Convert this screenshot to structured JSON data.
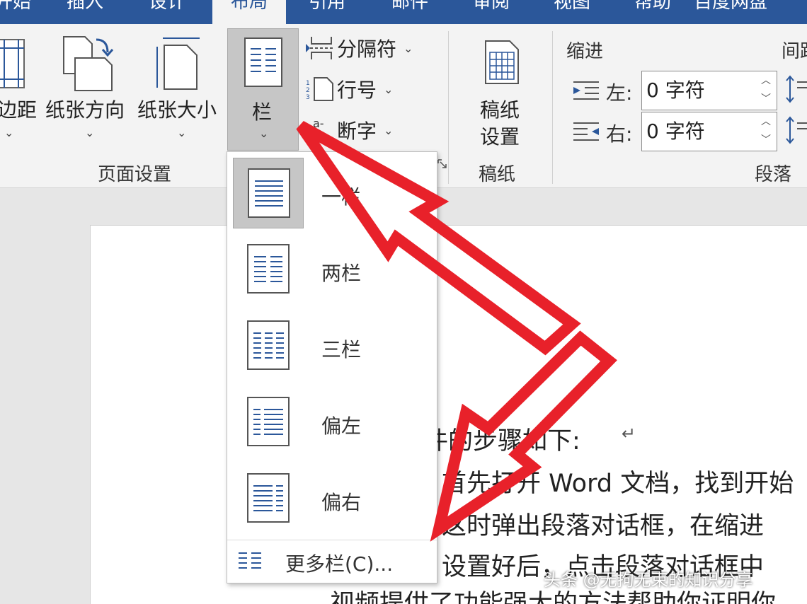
{
  "tabs": [
    {
      "label": "开始"
    },
    {
      "label": "插入"
    },
    {
      "label": "设计"
    },
    {
      "label": "布局",
      "active": true
    },
    {
      "label": "引用"
    },
    {
      "label": "邮件"
    },
    {
      "label": "审阅"
    },
    {
      "label": "视图"
    },
    {
      "label": "帮助"
    },
    {
      "label": "百度网盘"
    }
  ],
  "page_setup": {
    "margins_label": "边距",
    "orientation_label": "纸张方向",
    "size_label": "纸张大小",
    "columns_label": "栏",
    "breaks_label": "分隔符",
    "line_numbers_label": "行号",
    "hyphenation_label": "断字",
    "group_label": "页面设置"
  },
  "draft": {
    "settings_label_1": "稿纸",
    "settings_label_2": "设置",
    "group_label": "稿纸"
  },
  "paragraph": {
    "indent_title": "缩进",
    "spacing_title": "间距",
    "left_label": "左:",
    "left_value": "0 字符",
    "right_label": "右:",
    "right_value": "0 字符",
    "group_label": "段落"
  },
  "columns_menu": {
    "items": [
      {
        "label": "一栏",
        "selected": true,
        "icon": "one-column-icon"
      },
      {
        "label": "两栏",
        "icon": "two-columns-icon"
      },
      {
        "label": "三栏",
        "icon": "three-columns-icon"
      },
      {
        "label": "偏左",
        "icon": "left-column-icon"
      },
      {
        "label": "偏右",
        "icon": "right-column-icon"
      }
    ],
    "more_label": "更多栏(C)..."
  },
  "document": {
    "lines": [
      "件的步骤如下:",
      "首先打开 Word 文档，找到开始",
      "这时弹出段落对话框，在缩进",
      "设置好后，点击段落对话框中",
      "视频提供了功能强大的方法帮助你证明你"
    ]
  },
  "watermark": "头条 @无拘无束的知识分享",
  "colors": {
    "accent": "#2b579a",
    "annotation_arrow": "#e8212a"
  }
}
